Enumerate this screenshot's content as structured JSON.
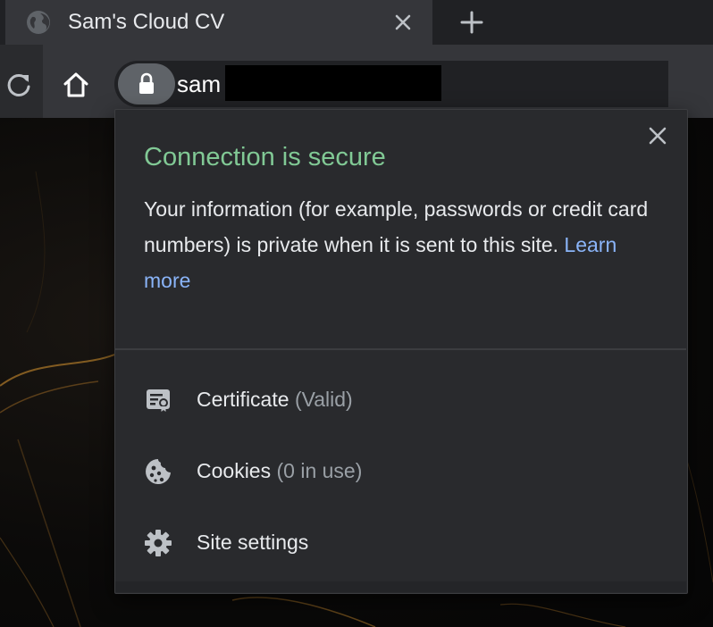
{
  "tab": {
    "title": "Sam's Cloud CV",
    "favicon": "globe-icon",
    "close_icon": "close-icon"
  },
  "new_tab": {
    "icon": "plus-icon"
  },
  "toolbar": {
    "reload_icon": "reload-icon",
    "home_icon": "home-icon",
    "lock_icon": "lock-icon",
    "url_visible": "sam"
  },
  "site_info": {
    "title": "Connection is secure",
    "body_text": "Your information (for example, passwords or credit card numbers) is private when it is sent to this site.",
    "learn_more": "Learn more",
    "close_icon": "close-icon",
    "items": [
      {
        "icon": "certificate-icon",
        "label": "Certificate",
        "detail": "(Valid)"
      },
      {
        "icon": "cookie-icon",
        "label": "Cookies",
        "detail": "(0 in use)"
      },
      {
        "icon": "gear-icon",
        "label": "Site settings",
        "detail": ""
      }
    ]
  },
  "colors": {
    "secure_green": "#81c995",
    "link_blue": "#8ab4f8",
    "popup_bg": "#292a2d",
    "toolbar_bg": "#35363a",
    "tabstrip_bg": "#202124"
  }
}
